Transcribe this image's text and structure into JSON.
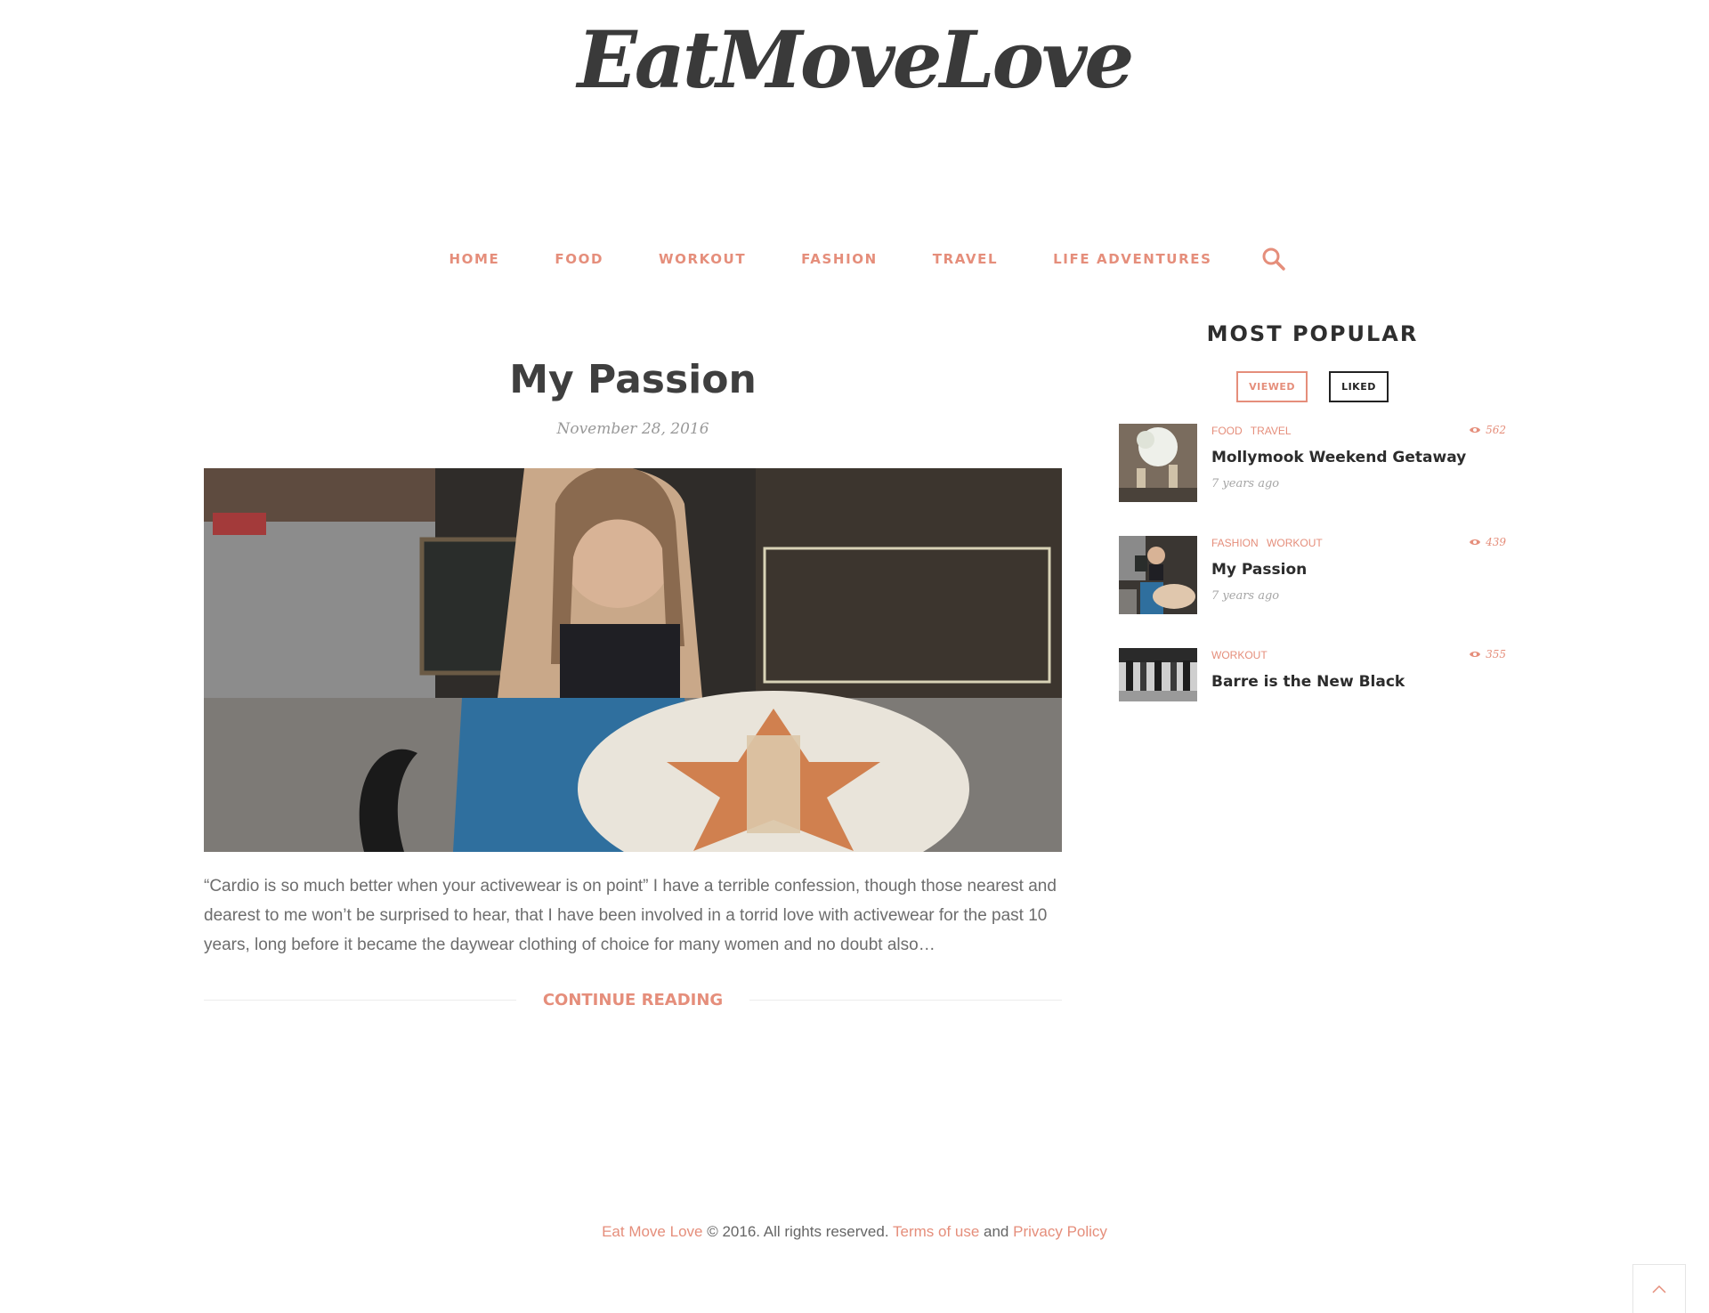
{
  "site": {
    "logo_text": "EatMoveLove",
    "accent_color": "#e58e7b"
  },
  "nav": {
    "items": [
      {
        "label": "HOME"
      },
      {
        "label": "FOOD"
      },
      {
        "label": "WORKOUT"
      },
      {
        "label": "FASHION"
      },
      {
        "label": "TRAVEL"
      },
      {
        "label": "LIFE ADVENTURES"
      }
    ],
    "search_icon": "search-icon"
  },
  "post": {
    "title": "My Passion",
    "date": "November 28, 2016",
    "excerpt": "“Cardio is so much better when your activewear is on point” I have a terrible confession, though those nearest and dearest to me won’t be surprised to hear, that I have been involved in a torrid love  with activewear for the past 10 years, long before it became the daywear clothing of choice for many women and no doubt also…",
    "continue_label": "CONTINUE READING"
  },
  "sidebar": {
    "title": "MOST POPULAR",
    "tabs": [
      {
        "label": "VIEWED",
        "active": true
      },
      {
        "label": "LIKED",
        "active": false
      }
    ],
    "items": [
      {
        "categories": [
          "FOOD",
          "TRAVEL"
        ],
        "views": "562",
        "title": "Mollymook Weekend Getaway",
        "ago": "7 years ago"
      },
      {
        "categories": [
          "FASHION",
          "WORKOUT"
        ],
        "views": "439",
        "title": "My Passion",
        "ago": "7 years ago"
      },
      {
        "categories": [
          "WORKOUT"
        ],
        "views": "355",
        "title": "Barre is the New Black",
        "ago": ""
      }
    ]
  },
  "footer": {
    "site_link": "Eat Move Love",
    "copyright": " © 2016. All rights reserved. ",
    "terms_link": "Terms of use",
    "and": " and ",
    "privacy_link": "Privacy Policy"
  }
}
